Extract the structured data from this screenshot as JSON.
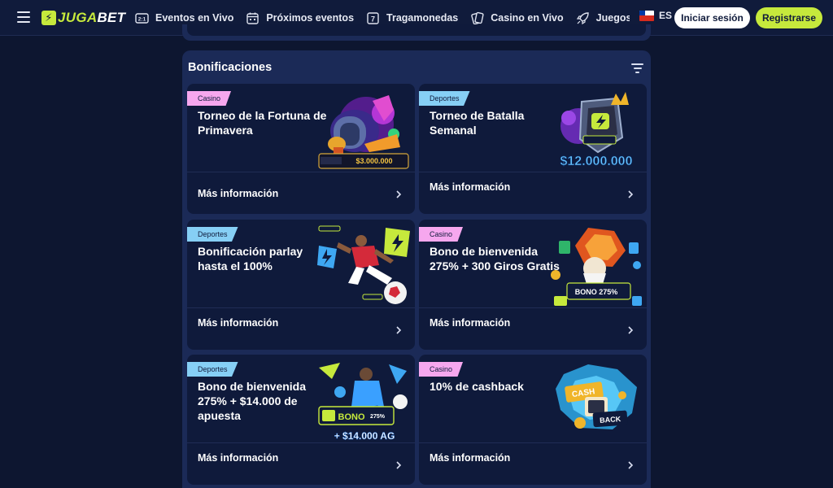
{
  "header": {
    "logo_part1": "JUGA",
    "logo_part2": "BET",
    "nav": [
      {
        "label": "Eventos en Vivo",
        "icon": "live-events-icon"
      },
      {
        "label": "Próximos eventos",
        "icon": "calendar-icon"
      },
      {
        "label": "Tragamonedas",
        "icon": "slot-machine-icon"
      },
      {
        "label": "Casino en Vivo",
        "icon": "cards-icon"
      },
      {
        "label": "Juegos instant",
        "icon": "rocket-icon"
      }
    ],
    "language": "ES",
    "login_label": "Iniciar sesión",
    "register_label": "Registrarse"
  },
  "bonuses": {
    "title": "Bonificaciones",
    "more_label": "Más información",
    "cards": [
      {
        "category": "Casino",
        "title": "Torneo de la Fortuna de Primavera",
        "art_text": "$3.000.000"
      },
      {
        "category": "Deportes",
        "title": "Torneo de Batalla Semanal",
        "art_text": "$12.000.000"
      },
      {
        "category": "Deportes",
        "title": "Bonificación parlay hasta el 100%",
        "art_text": ""
      },
      {
        "category": "Casino",
        "title": "Bono de bienvenida 275% + 300 Giros Gratis",
        "art_text": "BONO 275%"
      },
      {
        "category": "Deportes",
        "title": "Bono de bienvenida 275% + $14.000 de apuesta",
        "art_text": "+ $14.000 AG"
      },
      {
        "category": "Casino",
        "title": "10% de cashback",
        "art_text": "CASH BACK"
      }
    ]
  },
  "colors": {
    "accent": "#c6e93c",
    "casino_badge": "#f6a7ee",
    "deportes_badge": "#86cff5",
    "panel": "#1b2a57",
    "card": "#0f1a3b"
  }
}
